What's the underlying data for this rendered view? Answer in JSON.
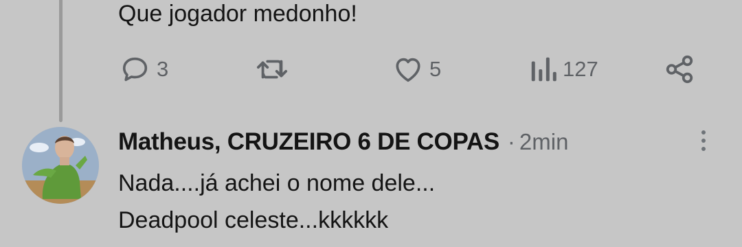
{
  "parent_tweet": {
    "text": "Que jogador medonho!",
    "actions": {
      "replies": "3",
      "retweets": "",
      "likes": "5",
      "views": "127"
    }
  },
  "reply_tweet": {
    "author": "Matheus, CRUZEIRO 6 DE COPAS",
    "separator": "·",
    "time": "2min",
    "lines": [
      "Nada....já achei o nome dele...",
      "Deadpool celeste...kkkkkk"
    ]
  },
  "icons": {
    "reply": "speech-bubble-icon",
    "retweet": "retweet-arrows-icon",
    "like": "heart-icon",
    "views": "bar-chart-icon",
    "share": "share-nodes-icon",
    "more": "vertical-dots-icon"
  },
  "colors": {
    "background": "#c6c6c6",
    "text": "#141414",
    "muted": "#5f6266",
    "thread_line": "#9a9a9a"
  }
}
